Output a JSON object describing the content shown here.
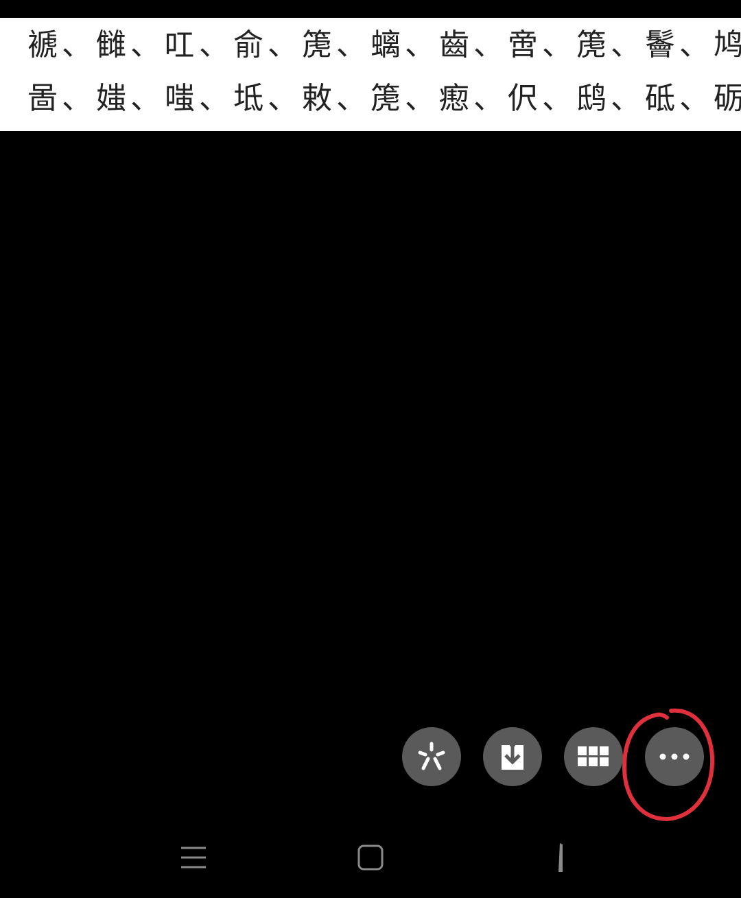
{
  "document": {
    "line_1": "褫、雠、叿、俞、箎、螭、齒、啻、箎、鬠、鸠、",
    "line_2": "啚、媸、嗤、坻、敕、箎、瘛、伬、鸱、砥、砺、"
  },
  "toolbar": {
    "buttons": [
      {
        "name": "sparkle-icon"
      },
      {
        "name": "download-icon"
      },
      {
        "name": "grid-icon"
      },
      {
        "name": "more-icon"
      }
    ]
  },
  "annotation": {
    "color": "#e0303c",
    "target": "more-button"
  },
  "navbar": {
    "items": [
      {
        "name": "recent-apps-icon"
      },
      {
        "name": "home-icon"
      },
      {
        "name": "back-icon"
      }
    ]
  },
  "colors": {
    "background": "#000000",
    "panel": "#ffffff",
    "button": "#5a5a5a",
    "icon": "#ffffff",
    "nav_icon": "#8a8a8a"
  }
}
